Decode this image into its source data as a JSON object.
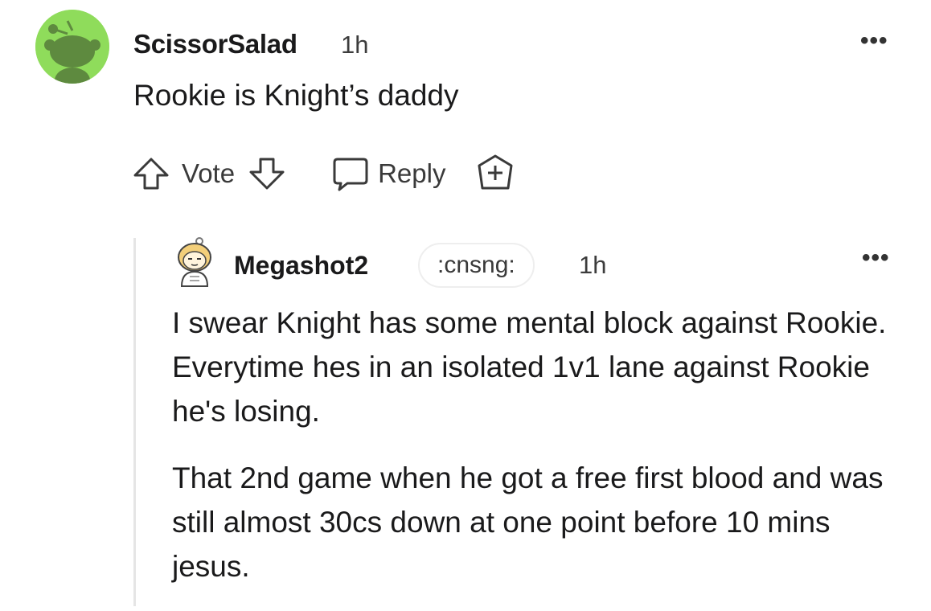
{
  "comment": {
    "username": "ScissorSalad",
    "time": "1h",
    "body": "Rookie is Knight’s daddy",
    "more_icon": "more-horizontal-icon",
    "avatar_color": "#8fdc5b",
    "actions": {
      "upvote_icon": "upvote-arrow-icon",
      "vote_label": "Vote",
      "downvote_icon": "downvote-arrow-icon",
      "reply_icon": "speech-bubble-icon",
      "reply_label": "Reply",
      "award_icon": "award-plus-icon"
    }
  },
  "reply": {
    "username": "Megashot2",
    "flair": ":cnsng:",
    "time": "1h",
    "more_icon": "more-horizontal-icon",
    "paragraphs": [
      "I swear Knight has some mental block against Rookie. Everytime hes in an isolated 1v1 lane against Rookie he's losing.",
      "That 2nd game when he got a free first blood and was still almost 30cs down at one point before 10 mins jesus."
    ]
  }
}
